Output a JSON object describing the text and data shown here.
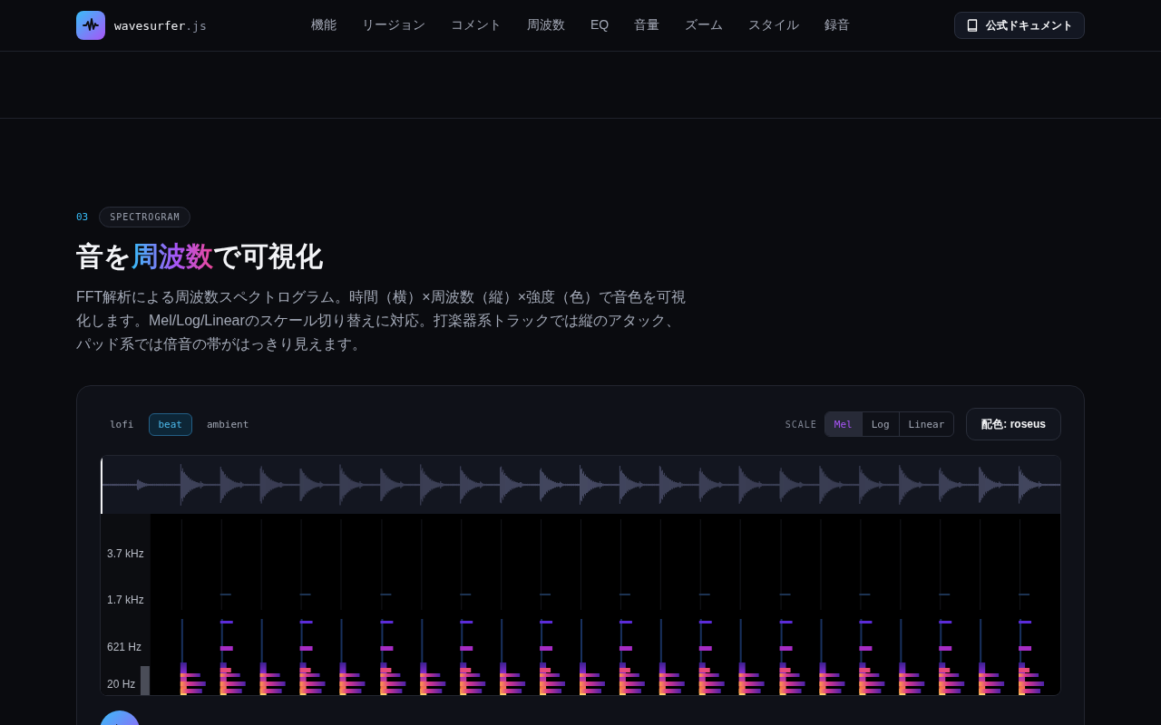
{
  "header": {
    "logo": {
      "name": "wavesurfer",
      "suffix": ".js"
    },
    "nav": [
      "機能",
      "リージョン",
      "コメント",
      "周波数",
      "EQ",
      "音量",
      "ズーム",
      "スタイル",
      "録音"
    ],
    "docs_button": "公式ドキュメント"
  },
  "section": {
    "number": "03",
    "tag": "SPECTROGRAM",
    "title": [
      {
        "text": "音を",
        "kind": "plain"
      },
      {
        "text": "周波数",
        "kind": "accent"
      },
      {
        "text": "で可視化",
        "kind": "plain"
      }
    ],
    "description": "FFT解析による周波数スペクトログラム。時間（横）×周波数（縦）×強度（色）で音色を可視化します。Mel/Log/Linearのスケール切り替えに対応。打楽器系トラックでは縦のアタック、パッド系では倍音の帯がはっきり見えます。"
  },
  "player": {
    "presets": [
      {
        "label": "lofi",
        "selected": false
      },
      {
        "label": "beat",
        "selected": true
      },
      {
        "label": "ambient",
        "selected": false
      }
    ],
    "scale_label": "SCALE",
    "scales": [
      {
        "label": "Mel",
        "selected": true
      },
      {
        "label": "Log",
        "selected": false
      },
      {
        "label": "Linear",
        "selected": false
      }
    ],
    "colormap_button": "配色: roseus",
    "frequency_labels": [
      "3.7 kHz",
      "1.7 kHz",
      "621 Hz",
      "20 Hz"
    ]
  }
}
